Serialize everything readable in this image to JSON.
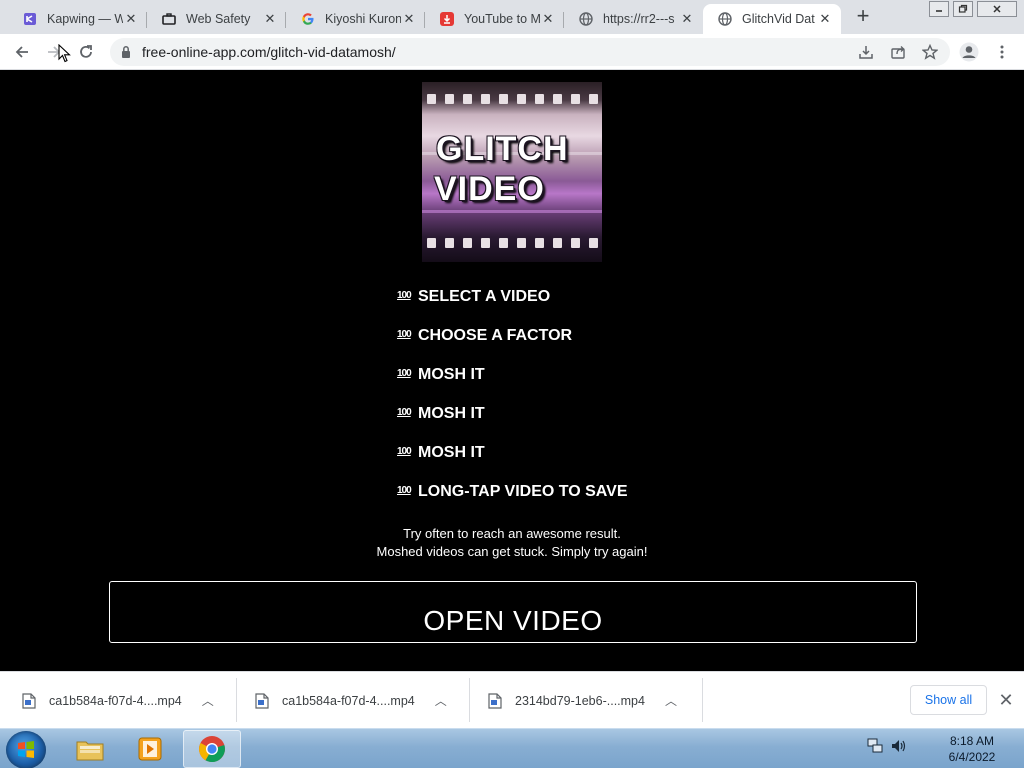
{
  "tabs": [
    {
      "title": "Kapwing — W",
      "icon": "kapwing-icon",
      "active": false
    },
    {
      "title": "Web Safety",
      "icon": "briefcase-icon",
      "active": false
    },
    {
      "title": "Kiyoshi Kuron",
      "icon": "google-icon",
      "active": false
    },
    {
      "title": "YouTube to M",
      "icon": "download-red-icon",
      "active": false
    },
    {
      "title": "https://rr2---s",
      "icon": "globe-icon",
      "active": false
    },
    {
      "title": "GlitchVid Dat",
      "icon": "globe-icon",
      "active": true
    }
  ],
  "toolbar": {
    "url": "free-online-app.com/glitch-vid-datamosh/"
  },
  "page": {
    "logo": {
      "line1": "GLITCH",
      "line2": "VIDEO"
    },
    "step_emoji": "100",
    "steps": [
      "SELECT A VIDEO",
      "CHOOSE A FACTOR",
      "MOSH IT",
      "MOSH IT",
      "MOSH IT",
      "LONG-TAP VIDEO TO SAVE"
    ],
    "note1": "Try often to reach an awesome result.",
    "note2": "Moshed videos can get stuck. Simply try again!",
    "open_button": "OPEN VIDEO"
  },
  "downloads": {
    "items": [
      {
        "name": "ca1b584a-f07d-4....mp4"
      },
      {
        "name": "ca1b584a-f07d-4....mp4"
      },
      {
        "name": "2314bd79-1eb6-....mp4"
      }
    ],
    "show_all": "Show all"
  },
  "taskbar": {
    "time": "8:18 AM",
    "date": "6/4/2022"
  },
  "colors": {
    "page_bg": "#000000",
    "tab_strip": "#dee1e6",
    "accent_link": "#1a73e8"
  }
}
